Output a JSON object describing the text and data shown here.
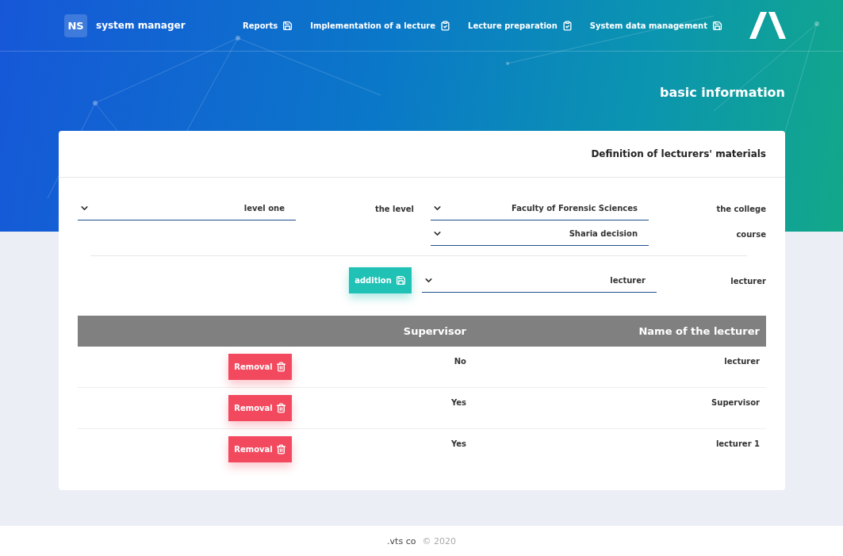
{
  "brand": {
    "badge": "NS",
    "title": "system manager"
  },
  "nav": [
    {
      "label": "Reports"
    },
    {
      "label": "Implementation of a lecture"
    },
    {
      "label": "Lecture preparation"
    },
    {
      "label": "System data management"
    }
  ],
  "page_title": "basic information",
  "card": {
    "title": "Definition of lecturers' materials",
    "form_rows": [
      [
        {
          "kind": "select",
          "value": "level one"
        },
        {
          "kind": "label",
          "text": "the level"
        },
        {
          "kind": "select",
          "value": "Faculty of Forensic Sciences"
        },
        {
          "kind": "label",
          "text": "the college"
        }
      ],
      [
        {
          "kind": "select",
          "value": "Sharia decision"
        },
        {
          "kind": "label",
          "text": "course"
        }
      ],
      [
        {
          "kind": "button",
          "text": "addition"
        },
        {
          "kind": "select",
          "value": "lecturer"
        },
        {
          "kind": "label",
          "text": "lecturer"
        }
      ]
    ],
    "table": {
      "columns": [
        "Supervisor",
        "Name of the lecturer"
      ],
      "rows": [
        {
          "action": "Removal",
          "supervisor": "No",
          "name": "lecturer"
        },
        {
          "action": "Removal",
          "supervisor": "Yes",
          "name": "Supervisor"
        },
        {
          "action": "Removal",
          "supervisor": "Yes",
          "name": "lecturer 1"
        }
      ]
    }
  },
  "footer": {
    "company": ".vts co",
    "copyright": "© 2020"
  }
}
